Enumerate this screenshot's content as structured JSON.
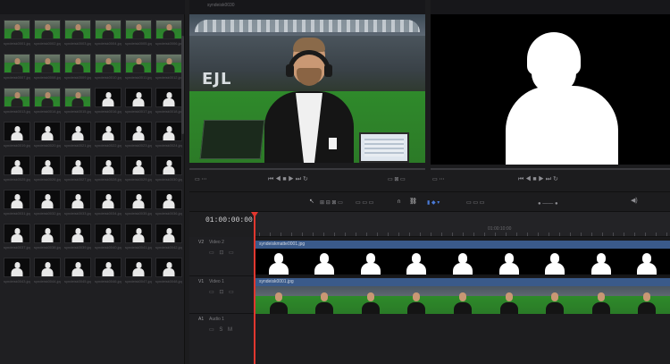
{
  "media_pool": {
    "clips": [
      {
        "name": "syndeisk0001.jpg",
        "kind": "color"
      },
      {
        "name": "syndeisk0002.jpg",
        "kind": "color"
      },
      {
        "name": "syndeisk0003.jpg",
        "kind": "color"
      },
      {
        "name": "syndeisk0004.jpg",
        "kind": "color"
      },
      {
        "name": "syndeisk0005.jpg",
        "kind": "color"
      },
      {
        "name": "syndeisk0006.jpg",
        "kind": "color"
      },
      {
        "name": "syndeisk0007.jpg",
        "kind": "color"
      },
      {
        "name": "syndeisk0008.jpg",
        "kind": "color"
      },
      {
        "name": "syndeisk0009.jpg",
        "kind": "color"
      },
      {
        "name": "syndeisk0010.jpg",
        "kind": "color"
      },
      {
        "name": "syndeisk0011.jpg",
        "kind": "color"
      },
      {
        "name": "syndeisk0012.jpg",
        "kind": "color"
      },
      {
        "name": "syndeisk0013.jpg",
        "kind": "color"
      },
      {
        "name": "syndeisk0014.jpg",
        "kind": "color"
      },
      {
        "name": "syndeisk0015.jpg",
        "kind": "color"
      },
      {
        "name": "syndeisk0016.jpg",
        "kind": "matte"
      },
      {
        "name": "syndeisk0017.jpg",
        "kind": "matte"
      },
      {
        "name": "syndeisk0018.jpg",
        "kind": "matte"
      },
      {
        "name": "syndeisk0019.jpg",
        "kind": "matte"
      },
      {
        "name": "syndeisk0020.jpg",
        "kind": "matte"
      },
      {
        "name": "syndeisk0021.jpg",
        "kind": "matte"
      },
      {
        "name": "syndeisk0022.jpg",
        "kind": "matte"
      },
      {
        "name": "syndeisk0023.jpg",
        "kind": "matte"
      },
      {
        "name": "syndeisk0024.jpg",
        "kind": "matte"
      },
      {
        "name": "syndeisk0025.jpg",
        "kind": "matte"
      },
      {
        "name": "syndeisk0026.jpg",
        "kind": "matte"
      },
      {
        "name": "syndeisk0027.jpg",
        "kind": "matte"
      },
      {
        "name": "syndeisk0028.jpg",
        "kind": "matte"
      },
      {
        "name": "syndeisk0029.jpg",
        "kind": "matte"
      },
      {
        "name": "syndeisk0030.jpg",
        "kind": "matte"
      },
      {
        "name": "syndeisk0031.jpg",
        "kind": "matte"
      },
      {
        "name": "syndeisk0032.jpg",
        "kind": "matte"
      },
      {
        "name": "syndeisk0033.jpg",
        "kind": "matte"
      },
      {
        "name": "syndeisk0034.jpg",
        "kind": "matte"
      },
      {
        "name": "syndeisk0035.jpg",
        "kind": "matte"
      },
      {
        "name": "syndeisk0036.jpg",
        "kind": "matte"
      },
      {
        "name": "syndeisk0037.jpg",
        "kind": "matte"
      },
      {
        "name": "syndeisk0038.jpg",
        "kind": "matte"
      },
      {
        "name": "syndeisk0039.jpg",
        "kind": "matte"
      },
      {
        "name": "syndeisk0040.jpg",
        "kind": "matte"
      },
      {
        "name": "syndeisk0041.jpg",
        "kind": "matte"
      },
      {
        "name": "syndeisk0042.jpg",
        "kind": "matte"
      },
      {
        "name": "syndeisk0043.jpg",
        "kind": "matte"
      },
      {
        "name": "syndeisk0044.jpg",
        "kind": "matte"
      },
      {
        "name": "syndeisk0045.jpg",
        "kind": "matte"
      },
      {
        "name": "syndeisk0046.jpg",
        "kind": "matte"
      },
      {
        "name": "syndeisk0047.jpg",
        "kind": "matte"
      },
      {
        "name": "syndeisk0048.jpg",
        "kind": "matte"
      }
    ]
  },
  "source_viewer": {
    "clip_label": "syndeisk0030",
    "stand_letters": "EJL"
  },
  "timeline": {
    "timecode": "01:00:00:00",
    "ruler_time": "01:00:10:00",
    "tracks": [
      {
        "id": "V2",
        "name": "Video 2",
        "icons": "▭ ⊡ ▭"
      },
      {
        "id": "V1",
        "name": "Video 1",
        "icons": "▭ ⊡ ▭"
      },
      {
        "id": "A1",
        "name": "Audio 1",
        "icons": "▭ S M"
      }
    ],
    "v2_clip_label": "syndeiskmatte0001.jpg",
    "v1_clip_label": "syndeisk0001.jpg",
    "v2_thumb_count": 9,
    "v1_thumb_count": 9
  },
  "viewer_controls": {
    "left_transport": "⏮ ◀ ■ ▶ ⏭ ↻",
    "right_transport": "⏮ ◀ ■ ▶ ⏭ ↻"
  },
  "colors": {
    "playhead": "#e0372f",
    "clip_header": "#3a5a8a",
    "pitch": "#2f8a2b"
  }
}
